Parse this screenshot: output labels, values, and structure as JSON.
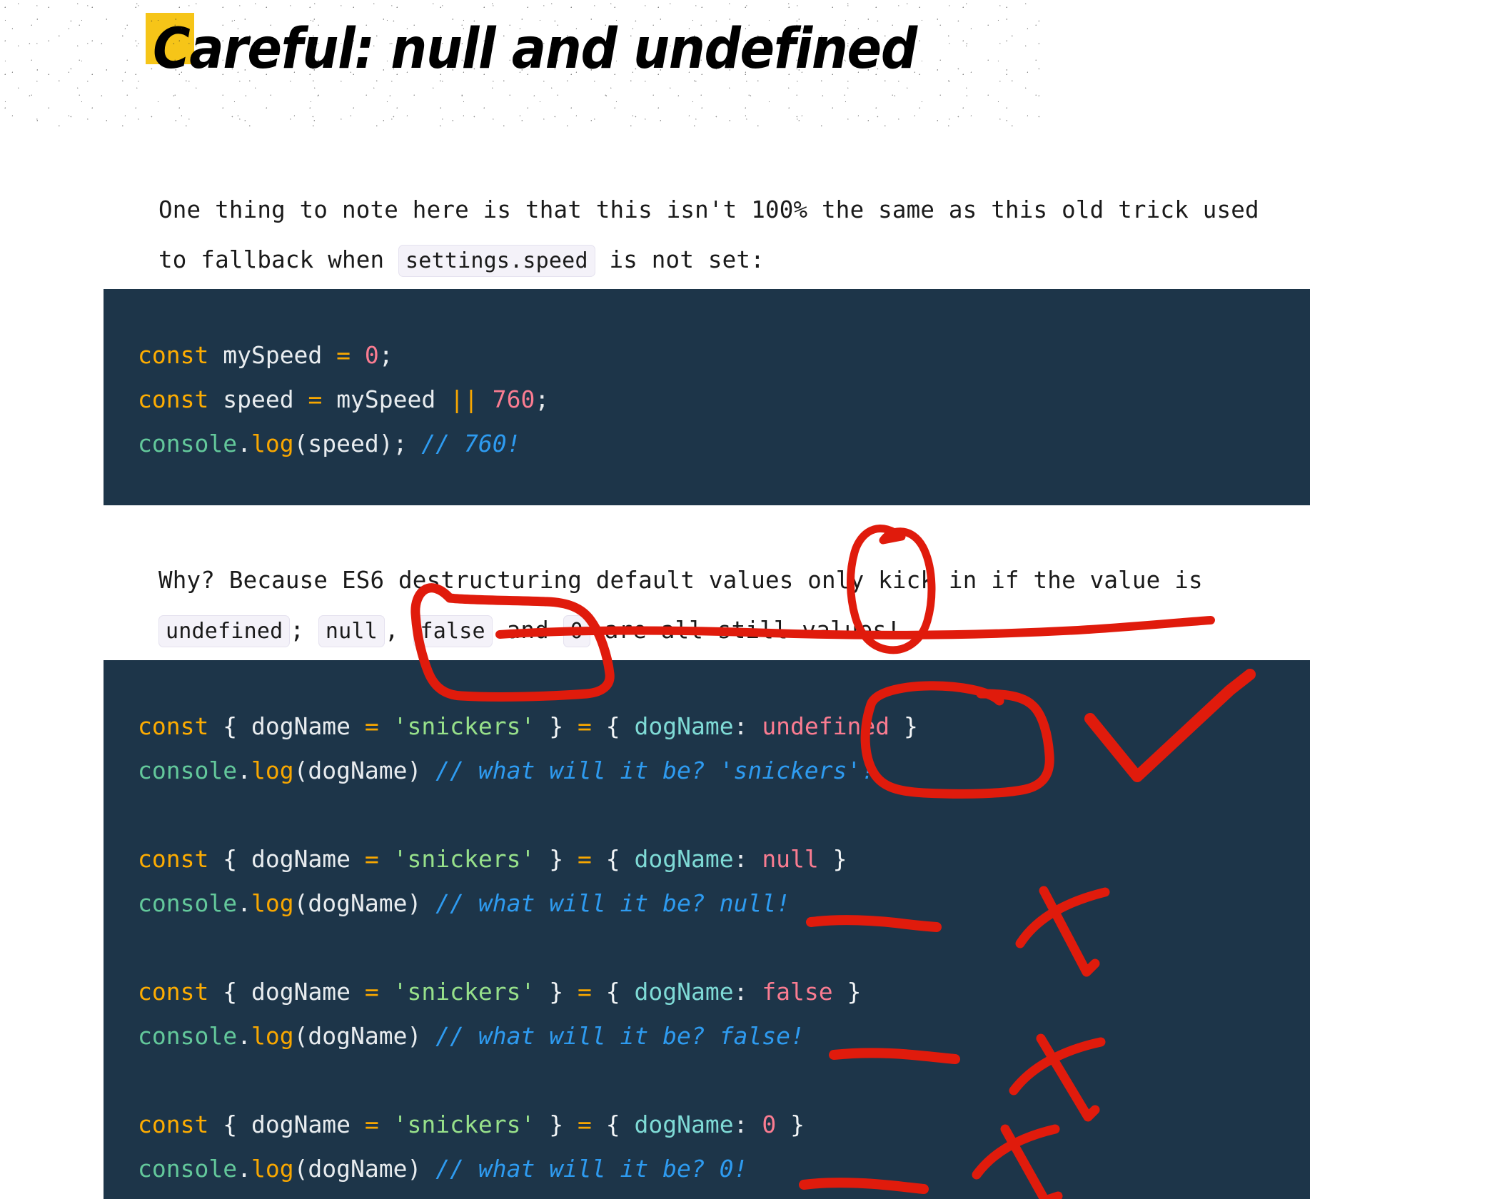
{
  "page": {
    "title": "Careful: null and undefined",
    "accent_swatch_color": "#f6c518",
    "code_bg_color": "#1d3549",
    "annotation_color": "#e01b0c"
  },
  "paragraphs": {
    "intro": {
      "part1": "One thing to note here is that this isn't 100% the same as this old trick used to fallback when ",
      "chip": "settings.speed",
      "part2": " is not set:"
    },
    "why": {
      "part1": "Why? Because ES6 destructuring default values only kick in if the value is ",
      "chip_undefined": "undefined",
      "part2": "; ",
      "chip_null": "null",
      "part3": ", ",
      "chip_false": "false",
      "part4": " and ",
      "chip_zero": "0",
      "part5": " are all still values!"
    }
  },
  "code_block_1": {
    "lines": [
      [
        {
          "t": "const",
          "c": "kw"
        },
        {
          "t": " ",
          "c": "plain"
        },
        {
          "t": "mySpeed",
          "c": "plain"
        },
        {
          "t": " ",
          "c": "plain"
        },
        {
          "t": "=",
          "c": "op"
        },
        {
          "t": " ",
          "c": "plain"
        },
        {
          "t": "0",
          "c": "num"
        },
        {
          "t": ";",
          "c": "plain"
        }
      ],
      [
        {
          "t": "const",
          "c": "kw"
        },
        {
          "t": " ",
          "c": "plain"
        },
        {
          "t": "speed",
          "c": "plain"
        },
        {
          "t": " ",
          "c": "plain"
        },
        {
          "t": "=",
          "c": "op"
        },
        {
          "t": " ",
          "c": "plain"
        },
        {
          "t": "mySpeed",
          "c": "plain"
        },
        {
          "t": " ",
          "c": "plain"
        },
        {
          "t": "||",
          "c": "op"
        },
        {
          "t": " ",
          "c": "plain"
        },
        {
          "t": "760",
          "c": "num"
        },
        {
          "t": ";",
          "c": "plain"
        }
      ],
      [
        {
          "t": "console",
          "c": "green"
        },
        {
          "t": ".",
          "c": "plain"
        },
        {
          "t": "log",
          "c": "fn"
        },
        {
          "t": "(speed); ",
          "c": "plain"
        },
        {
          "t": "// 760!",
          "c": "cmt"
        }
      ]
    ]
  },
  "code_block_2": {
    "lines": [
      [
        {
          "t": "const",
          "c": "kw"
        },
        {
          "t": " ",
          "c": "plain"
        },
        {
          "t": "{",
          "c": "punct"
        },
        {
          "t": " ",
          "c": "plain"
        },
        {
          "t": "dogName",
          "c": "plain"
        },
        {
          "t": " ",
          "c": "plain"
        },
        {
          "t": "=",
          "c": "op"
        },
        {
          "t": " ",
          "c": "plain"
        },
        {
          "t": "'snickers'",
          "c": "str"
        },
        {
          "t": " ",
          "c": "plain"
        },
        {
          "t": "}",
          "c": "punct"
        },
        {
          "t": " ",
          "c": "plain"
        },
        {
          "t": "=",
          "c": "op"
        },
        {
          "t": " ",
          "c": "plain"
        },
        {
          "t": "{",
          "c": "punct"
        },
        {
          "t": " ",
          "c": "plain"
        },
        {
          "t": "dogName",
          "c": "key"
        },
        {
          "t": ": ",
          "c": "plain"
        },
        {
          "t": "undefined",
          "c": "num"
        },
        {
          "t": " ",
          "c": "plain"
        },
        {
          "t": "}",
          "c": "punct"
        }
      ],
      [
        {
          "t": "console",
          "c": "green"
        },
        {
          "t": ".",
          "c": "plain"
        },
        {
          "t": "log",
          "c": "fn"
        },
        {
          "t": "(dogName) ",
          "c": "plain"
        },
        {
          "t": "// what will it be? 'snickers'!",
          "c": "cmt"
        }
      ],
      [],
      [
        {
          "t": "const",
          "c": "kw"
        },
        {
          "t": " ",
          "c": "plain"
        },
        {
          "t": "{",
          "c": "punct"
        },
        {
          "t": " ",
          "c": "plain"
        },
        {
          "t": "dogName",
          "c": "plain"
        },
        {
          "t": " ",
          "c": "plain"
        },
        {
          "t": "=",
          "c": "op"
        },
        {
          "t": " ",
          "c": "plain"
        },
        {
          "t": "'snickers'",
          "c": "str"
        },
        {
          "t": " ",
          "c": "plain"
        },
        {
          "t": "}",
          "c": "punct"
        },
        {
          "t": " ",
          "c": "plain"
        },
        {
          "t": "=",
          "c": "op"
        },
        {
          "t": " ",
          "c": "plain"
        },
        {
          "t": "{",
          "c": "punct"
        },
        {
          "t": " ",
          "c": "plain"
        },
        {
          "t": "dogName",
          "c": "key"
        },
        {
          "t": ": ",
          "c": "plain"
        },
        {
          "t": "null",
          "c": "num"
        },
        {
          "t": " ",
          "c": "plain"
        },
        {
          "t": "}",
          "c": "punct"
        }
      ],
      [
        {
          "t": "console",
          "c": "green"
        },
        {
          "t": ".",
          "c": "plain"
        },
        {
          "t": "log",
          "c": "fn"
        },
        {
          "t": "(dogName) ",
          "c": "plain"
        },
        {
          "t": "// what will it be? null!",
          "c": "cmt"
        }
      ],
      [],
      [
        {
          "t": "const",
          "c": "kw"
        },
        {
          "t": " ",
          "c": "plain"
        },
        {
          "t": "{",
          "c": "punct"
        },
        {
          "t": " ",
          "c": "plain"
        },
        {
          "t": "dogName",
          "c": "plain"
        },
        {
          "t": " ",
          "c": "plain"
        },
        {
          "t": "=",
          "c": "op"
        },
        {
          "t": " ",
          "c": "plain"
        },
        {
          "t": "'snickers'",
          "c": "str"
        },
        {
          "t": " ",
          "c": "plain"
        },
        {
          "t": "}",
          "c": "punct"
        },
        {
          "t": " ",
          "c": "plain"
        },
        {
          "t": "=",
          "c": "op"
        },
        {
          "t": " ",
          "c": "plain"
        },
        {
          "t": "{",
          "c": "punct"
        },
        {
          "t": " ",
          "c": "plain"
        },
        {
          "t": "dogName",
          "c": "key"
        },
        {
          "t": ": ",
          "c": "plain"
        },
        {
          "t": "false",
          "c": "num"
        },
        {
          "t": " ",
          "c": "plain"
        },
        {
          "t": "}",
          "c": "punct"
        }
      ],
      [
        {
          "t": "console",
          "c": "green"
        },
        {
          "t": ".",
          "c": "plain"
        },
        {
          "t": "log",
          "c": "fn"
        },
        {
          "t": "(dogName) ",
          "c": "plain"
        },
        {
          "t": "// what will it be? false!",
          "c": "cmt"
        }
      ],
      [],
      [
        {
          "t": "const",
          "c": "kw"
        },
        {
          "t": " ",
          "c": "plain"
        },
        {
          "t": "{",
          "c": "punct"
        },
        {
          "t": " ",
          "c": "plain"
        },
        {
          "t": "dogName",
          "c": "plain"
        },
        {
          "t": " ",
          "c": "plain"
        },
        {
          "t": "=",
          "c": "op"
        },
        {
          "t": " ",
          "c": "plain"
        },
        {
          "t": "'snickers'",
          "c": "str"
        },
        {
          "t": " ",
          "c": "plain"
        },
        {
          "t": "}",
          "c": "punct"
        },
        {
          "t": " ",
          "c": "plain"
        },
        {
          "t": "=",
          "c": "op"
        },
        {
          "t": " ",
          "c": "plain"
        },
        {
          "t": "{",
          "c": "punct"
        },
        {
          "t": " ",
          "c": "plain"
        },
        {
          "t": "dogName",
          "c": "key"
        },
        {
          "t": ": ",
          "c": "plain"
        },
        {
          "t": "0",
          "c": "num"
        },
        {
          "t": " ",
          "c": "plain"
        },
        {
          "t": "}",
          "c": "punct"
        }
      ],
      [
        {
          "t": "console",
          "c": "green"
        },
        {
          "t": ".",
          "c": "plain"
        },
        {
          "t": "log",
          "c": "fn"
        },
        {
          "t": "(dogName) ",
          "c": "plain"
        },
        {
          "t": "// what will it be? 0!",
          "c": "cmt"
        }
      ]
    ]
  },
  "annotations": [
    {
      "name": "circle-only",
      "kind": "circle",
      "note": "circles the word only"
    },
    {
      "name": "circle-undefined-prose",
      "kind": "circle",
      "note": "circles the undefined chip"
    },
    {
      "name": "underline-values",
      "kind": "underline",
      "note": "underlines are all still values"
    },
    {
      "name": "circle-undefined-code",
      "kind": "circle",
      "note": "circles undefined in code"
    },
    {
      "name": "checkmark",
      "kind": "check",
      "note": "tick beside undefined example"
    },
    {
      "name": "underline-null",
      "kind": "underline",
      "note": "underlines null! comment"
    },
    {
      "name": "cross-null",
      "kind": "cross",
      "note": "X beside null example"
    },
    {
      "name": "underline-false",
      "kind": "underline",
      "note": "underlines false! comment"
    },
    {
      "name": "cross-false",
      "kind": "cross",
      "note": "X beside false example"
    },
    {
      "name": "underline-zero",
      "kind": "underline",
      "note": "underlines 0! comment"
    },
    {
      "name": "cross-zero",
      "kind": "cross",
      "note": "X beside 0 example"
    }
  ]
}
